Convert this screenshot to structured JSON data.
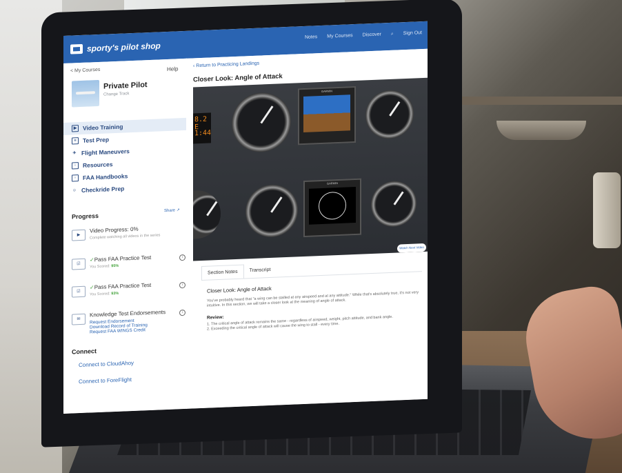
{
  "header": {
    "logo_text": "sporty's pilot shop",
    "nav": [
      "Notes",
      "My Courses",
      "Discover",
      "Sign Out"
    ],
    "search_icon": "search-icon"
  },
  "sidebar": {
    "my_courses": "< My Courses",
    "help": "Help",
    "course_title": "Private Pilot",
    "course_sub": "Change Track",
    "menu": [
      {
        "label": "Video Training",
        "icon": "video-icon",
        "active": true
      },
      {
        "label": "Test Prep",
        "icon": "document-icon"
      },
      {
        "label": "Flight Maneuvers",
        "icon": "plane-icon"
      },
      {
        "label": "Resources",
        "icon": "book-icon"
      },
      {
        "label": "FAA Handbooks",
        "icon": "handbook-icon"
      },
      {
        "label": "Checkride Prep",
        "icon": "person-icon"
      }
    ],
    "progress": {
      "heading": "Progress",
      "share": "Share",
      "video_progress": "Video Progress: 0%",
      "video_note": "Complete watching all videos in the series",
      "test1_title": "Pass FAA Practice Test",
      "test1_score_label": "You Scored:",
      "test1_score": "95%",
      "test2_title": "Pass FAA Practice Test",
      "test2_score_label": "You Scored:",
      "test2_score": "93%",
      "endorse_title": "Knowledge Test Endorsements",
      "links": [
        "Request Endorsement",
        "Download Record of Training",
        "Request FAA WINGS Credit"
      ]
    },
    "connect": {
      "heading": "Connect",
      "cloudahoy": "Connect to CloudAhoy",
      "foreflight": "Connect to ForeFlight"
    }
  },
  "main": {
    "back": "Return to Practicing Landings",
    "video_title": "Closer Look: Angle of Attack",
    "watch_next": "Watch Next Video",
    "instrument_readouts": [
      "8.2 E",
      "1:44"
    ],
    "tabs": [
      "Section Notes",
      "Transcript"
    ],
    "notes_title": "Closer Look: Angle of Attack",
    "notes_body": "You've probably heard that \"a wing can be stalled at any airspeed and at any attitude.\" While that's absolutely true, it's not very intuitive. In this section, we will take a closer look at the meaning of angle of attack.",
    "review_heading": "Review:",
    "review_items": [
      "1.   The critical angle of attack remains the same - regardless of airspeed, weight, pitch attitude, and bank angle.",
      "2.   Exceeding the critical angle of attack will cause the wing to stall - every time."
    ]
  },
  "colors": {
    "brand_blue": "#2a64b2",
    "score_green": "#42a23a"
  }
}
